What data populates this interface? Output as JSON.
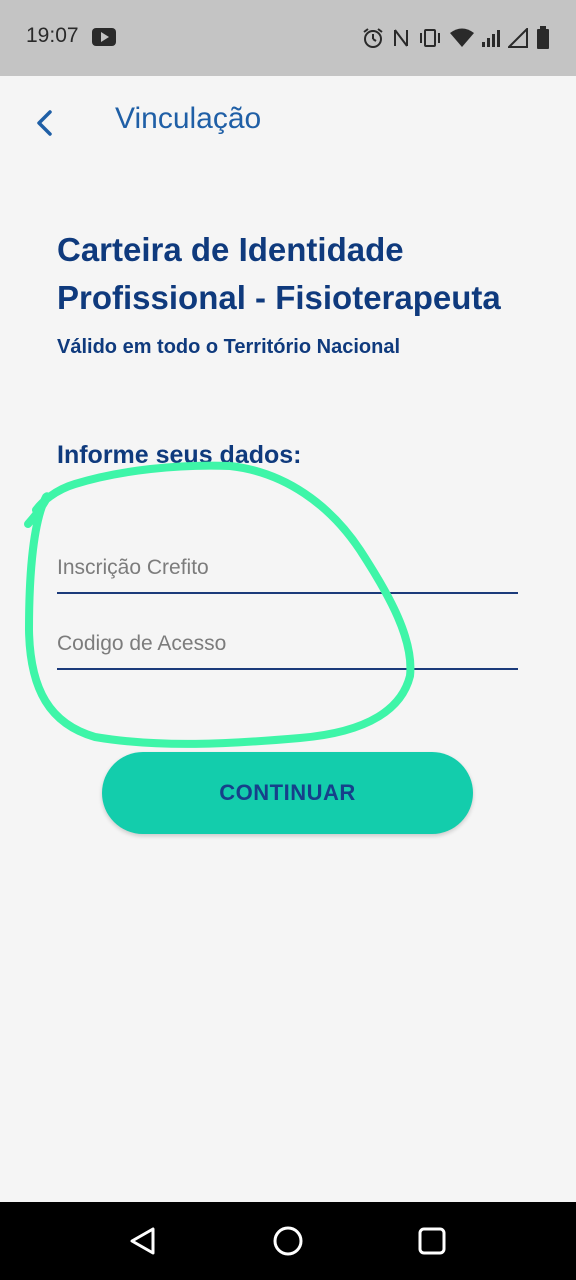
{
  "status_bar": {
    "time": "19:07",
    "left_icons": [
      "youtube-icon"
    ],
    "right_icons": [
      "alarm-icon",
      "nfc-icon",
      "vibrate-icon",
      "wifi-icon",
      "signal-icon",
      "signal-empty-icon",
      "battery-icon"
    ]
  },
  "header": {
    "title": "Vinculação",
    "back_icon": "chevron-left-icon"
  },
  "card": {
    "title": "Carteira de Identidade Profissional - Fisioterapeuta",
    "subtitle": "Válido em todo o Território Nacional"
  },
  "form": {
    "heading": "Informe seus dados:",
    "fields": [
      {
        "placeholder": "Inscrição Crefito",
        "value": ""
      },
      {
        "placeholder": "Codigo de Acesso",
        "value": ""
      }
    ],
    "submit_label": "CONTINUAR"
  },
  "nav_bar": {
    "buttons": [
      "back-triangle-icon",
      "home-circle-icon",
      "recents-square-icon"
    ]
  },
  "colors": {
    "primary_text": "#0f3a7d",
    "header_text": "#1f5fa6",
    "button_bg": "#13cdac",
    "annotation_stroke": "#3ef5a8",
    "status_bar_bg": "#c4c4c4",
    "background": "#f5f5f5"
  }
}
